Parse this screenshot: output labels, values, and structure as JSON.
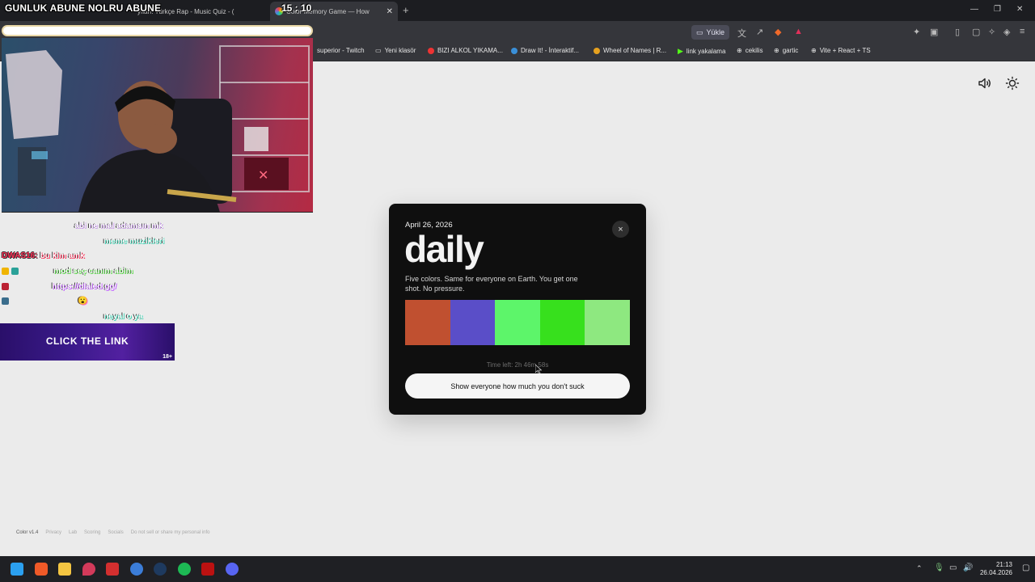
{
  "browser": {
    "tabs": [
      {
        "label": "yıları: Türkçe Rap - Music Quiz - ("
      },
      {
        "label": "Color Memory Game — How"
      }
    ],
    "toolbar_button": "Yükle",
    "bookmarks": [
      {
        "label": "superior - Twitch"
      },
      {
        "label": "Yeni klasör"
      },
      {
        "label": "BIZI ALKOL YIKAMA..."
      },
      {
        "label": "Draw It! - İnteraktif..."
      },
      {
        "label": "Wheel of Names | R..."
      },
      {
        "label": "link yakalama"
      },
      {
        "label": "cekilis"
      },
      {
        "label": "gartic"
      },
      {
        "label": "Vite + React + TS"
      }
    ]
  },
  "overlay": {
    "title": "GUNLUK ABUNE NOLRU ABUNE",
    "timer": "15 : 10",
    "chat": [
      {
        "user": "",
        "message": "abi ne mal adamsın mk",
        "color": "#c79be8"
      },
      {
        "user": "",
        "message": "meme muzikleri",
        "color": "#43d1b3"
      },
      {
        "user": "DWAS16:",
        "message": "bu kim amk",
        "color": "#ff2d55"
      },
      {
        "user": "",
        "message": "mod seç canım abim",
        "color": "#59d449"
      },
      {
        "user": "",
        "message": "https://dialed.gg/",
        "color": "#c163ff"
      },
      {
        "user": "",
        "message": "😮",
        "color": "#ff6ec7"
      },
      {
        "user": "",
        "message": "neyal o ya",
        "color": "#43d1b3"
      }
    ],
    "promo": {
      "text": "CLICK THE LINK",
      "age": "18+"
    }
  },
  "modal": {
    "date": "April 26, 2026",
    "title": "daily",
    "description": "Five colors. Same for everyone on Earth. You get one shot. No pressure.",
    "colors": [
      "#c05030",
      "#5a4ec8",
      "#5df56a",
      "#37e01d",
      "#8ee880"
    ],
    "time_left": "Time left: 2h 46m 58s",
    "share_button": "Show everyone how much you don't suck",
    "close_icon": "×"
  },
  "footer": {
    "items": [
      "Color v1.4",
      "Privacy",
      "Lab",
      "Scoring",
      "Socials",
      "Do not sell or share my personal info"
    ]
  },
  "taskbar": {
    "time": "21:13",
    "date": "26.04.2026"
  }
}
